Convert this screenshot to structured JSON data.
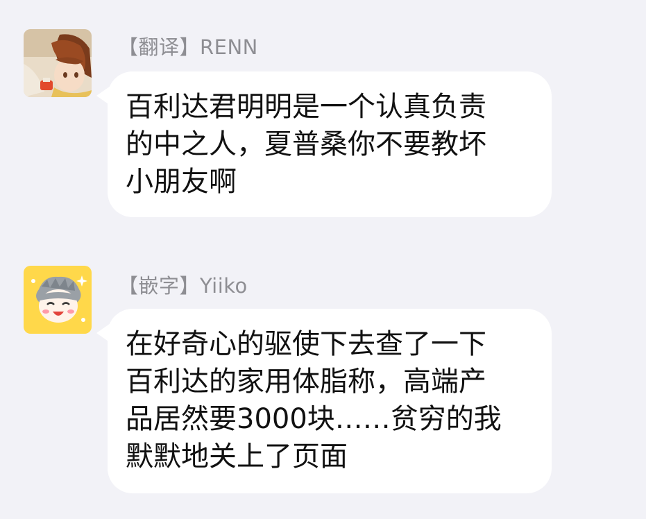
{
  "messages": [
    {
      "sender": "【翻译】RENN",
      "avatar": "anime-boy-avatar",
      "lines": [
        "百利达君明明是一个认真负责",
        "的中之人，夏普桑你不要教坏",
        "小朋友啊"
      ]
    },
    {
      "sender": "【嵌字】Yiiko",
      "avatar": "chibi-avatar",
      "lines": [
        "在好奇心的驱使下去查了一下",
        "百利达的家用体脂称，高端产",
        "品居然要3000块……贫穷的我",
        "默默地关上了页面"
      ]
    }
  ],
  "colors": {
    "background": "#f2f2f7",
    "bubble": "#ffffff",
    "sender_text": "#8e8e93",
    "message_text": "#111111",
    "chibi_avatar_bg": "#ffd84a"
  }
}
